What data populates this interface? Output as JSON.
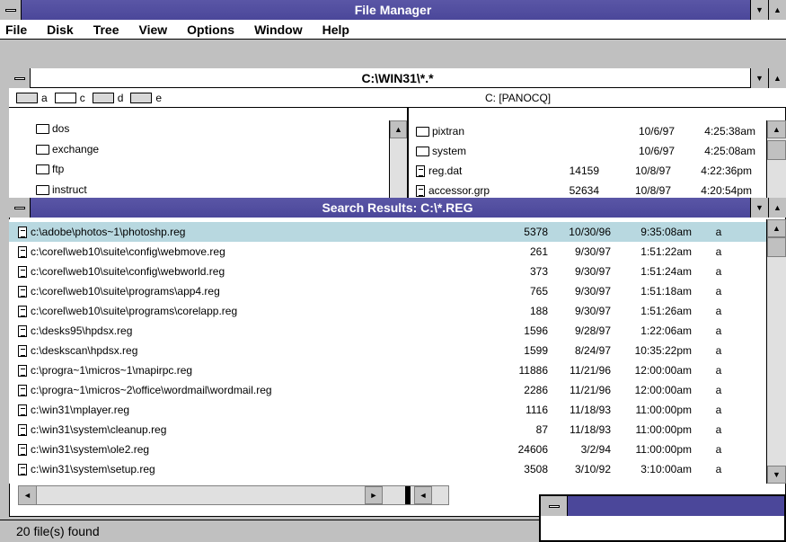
{
  "app": {
    "title": "File Manager"
  },
  "menu": [
    "File",
    "Disk",
    "Tree",
    "View",
    "Options",
    "Window",
    "Help"
  ],
  "dir_window": {
    "title": "C:\\WIN31\\*.*",
    "drives": [
      "a",
      "c",
      "d",
      "e"
    ],
    "volume_label": "C: [PANOCQ]",
    "tree": [
      "dos",
      "exchange",
      "ftp",
      "instruct"
    ],
    "files": [
      {
        "name": "pixtran",
        "size": "",
        "date": "10/6/97",
        "time": "4:25:38am",
        "kind": "folder"
      },
      {
        "name": "system",
        "size": "",
        "date": "10/6/97",
        "time": "4:25:08am",
        "kind": "folder"
      },
      {
        "name": "reg.dat",
        "size": "14159",
        "date": "10/8/97",
        "time": "4:22:36pm",
        "kind": "file"
      },
      {
        "name": "accessor.grp",
        "size": "52634",
        "date": "10/8/97",
        "time": "4:20:54pm",
        "kind": "file"
      }
    ]
  },
  "search": {
    "title": "Search Results: C:\\*.REG",
    "rows": [
      {
        "path": "c:\\adobe\\photos~1\\photoshp.reg",
        "size": "5378",
        "date": "10/30/96",
        "time": "9:35:08am",
        "attr": "a"
      },
      {
        "path": "c:\\corel\\web10\\suite\\config\\webmove.reg",
        "size": "261",
        "date": "9/30/97",
        "time": "1:51:22am",
        "attr": "a"
      },
      {
        "path": "c:\\corel\\web10\\suite\\config\\webworld.reg",
        "size": "373",
        "date": "9/30/97",
        "time": "1:51:24am",
        "attr": "a"
      },
      {
        "path": "c:\\corel\\web10\\suite\\programs\\app4.reg",
        "size": "765",
        "date": "9/30/97",
        "time": "1:51:18am",
        "attr": "a"
      },
      {
        "path": "c:\\corel\\web10\\suite\\programs\\corelapp.reg",
        "size": "188",
        "date": "9/30/97",
        "time": "1:51:26am",
        "attr": "a"
      },
      {
        "path": "c:\\desks95\\hpdsx.reg",
        "size": "1596",
        "date": "9/28/97",
        "time": "1:22:06am",
        "attr": "a"
      },
      {
        "path": "c:\\deskscan\\hpdsx.reg",
        "size": "1599",
        "date": "8/24/97",
        "time": "10:35:22pm",
        "attr": "a"
      },
      {
        "path": "c:\\progra~1\\micros~1\\mapirpc.reg",
        "size": "11886",
        "date": "11/21/96",
        "time": "12:00:00am",
        "attr": "a"
      },
      {
        "path": "c:\\progra~1\\micros~2\\office\\wordmail\\wordmail.reg",
        "size": "2286",
        "date": "11/21/96",
        "time": "12:00:00am",
        "attr": "a"
      },
      {
        "path": "c:\\win31\\mplayer.reg",
        "size": "1116",
        "date": "11/18/93",
        "time": "11:00:00pm",
        "attr": "a"
      },
      {
        "path": "c:\\win31\\system\\cleanup.reg",
        "size": "87",
        "date": "11/18/93",
        "time": "11:00:00pm",
        "attr": "a"
      },
      {
        "path": "c:\\win31\\system\\ole2.reg",
        "size": "24606",
        "date": "3/2/94",
        "time": "11:00:00pm",
        "attr": "a"
      },
      {
        "path": "c:\\win31\\system\\setup.reg",
        "size": "3508",
        "date": "3/10/92",
        "time": "3:10:00am",
        "attr": "a"
      }
    ]
  },
  "status": {
    "text": "20 file(s) found"
  },
  "colors": {
    "active_title": "#4b479a",
    "selection": "#b8d8e0",
    "chrome": "#c0c0c0"
  }
}
